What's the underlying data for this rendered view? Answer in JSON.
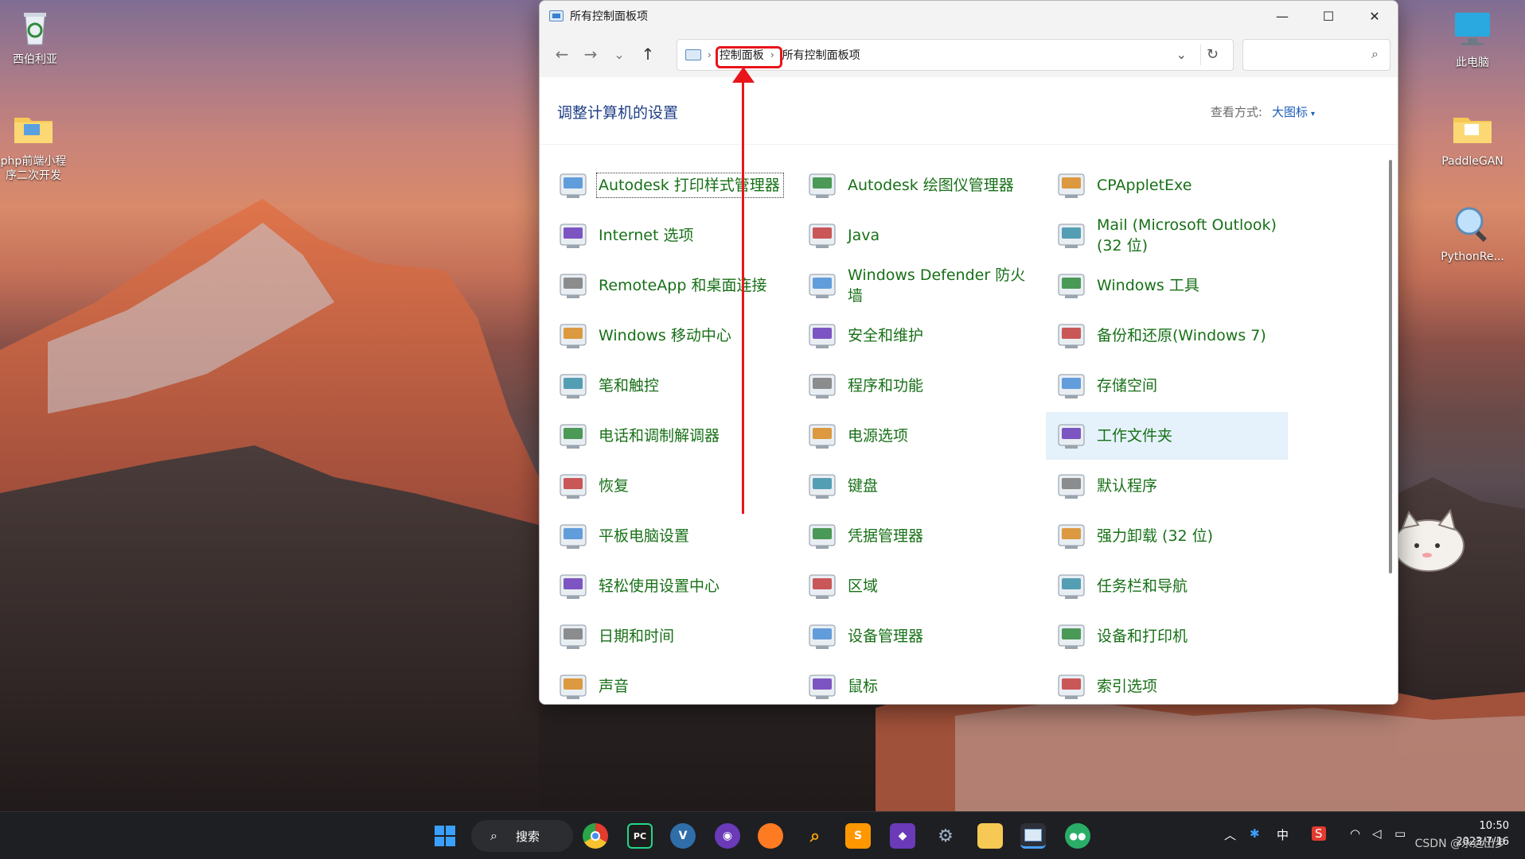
{
  "desktop": {
    "icons": [
      {
        "label": "西伯利亚"
      },
      {
        "label": "php前端小程序二次开发"
      },
      {
        "label": "此电脑"
      },
      {
        "label": "PaddleGAN"
      },
      {
        "label": "PythonRe..."
      }
    ]
  },
  "window": {
    "title": "所有控制面板项",
    "controls": {
      "minimize": "—",
      "maximize": "☐",
      "close": "✕"
    },
    "nav": {
      "back": "←",
      "forward": "→",
      "recent": "⌄",
      "up": "↑"
    },
    "address": {
      "crumb1": "控制面板",
      "crumb2": "所有控制面板项",
      "separator": "›",
      "dropdown": "⌄",
      "refresh": "↻"
    },
    "search": {
      "placeholder": "",
      "icon": "⌕"
    },
    "heading": "调整计算机的设置",
    "view_by": {
      "label": "查看方式:",
      "value": "大图标",
      "caret": "▾"
    }
  },
  "items": [
    {
      "label": "Autodesk 打印样式管理器",
      "icon": "printer-brush-icon",
      "focused": true
    },
    {
      "label": "Autodesk 绘图仪管理器",
      "icon": "plotter-icon"
    },
    {
      "label": "CPAppletExe",
      "icon": "blank-file-icon"
    },
    {
      "label": "Internet 选项",
      "icon": "globe-doc-icon"
    },
    {
      "label": "Java",
      "icon": "java-icon"
    },
    {
      "label": "Mail (Microsoft Outlook) (32 位)",
      "icon": "mail-icon"
    },
    {
      "label": "RemoteApp 和桌面连接",
      "icon": "remote-desktop-icon"
    },
    {
      "label": "Windows Defender 防火墙",
      "icon": "firewall-icon"
    },
    {
      "label": "Windows 工具",
      "icon": "gear-check-icon"
    },
    {
      "label": "Windows 移动中心",
      "icon": "mobility-center-icon"
    },
    {
      "label": "安全和维护",
      "icon": "flag-icon"
    },
    {
      "label": "备份和还原(Windows 7)",
      "icon": "backup-icon"
    },
    {
      "label": "笔和触控",
      "icon": "pen-icon"
    },
    {
      "label": "程序和功能",
      "icon": "programs-icon"
    },
    {
      "label": "存储空间",
      "icon": "storage-icon"
    },
    {
      "label": "电话和调制解调器",
      "icon": "phone-modem-icon"
    },
    {
      "label": "电源选项",
      "icon": "power-icon"
    },
    {
      "label": "工作文件夹",
      "icon": "work-folder-icon",
      "hover": true
    },
    {
      "label": "恢复",
      "icon": "recovery-icon"
    },
    {
      "label": "键盘",
      "icon": "keyboard-icon"
    },
    {
      "label": "默认程序",
      "icon": "default-programs-icon"
    },
    {
      "label": "平板电脑设置",
      "icon": "tablet-icon"
    },
    {
      "label": "凭据管理器",
      "icon": "credential-icon"
    },
    {
      "label": "强力卸载 (32 位)",
      "icon": "uninstall-clover-icon"
    },
    {
      "label": "轻松使用设置中心",
      "icon": "ease-of-access-icon"
    },
    {
      "label": "区域",
      "icon": "region-globe-icon"
    },
    {
      "label": "任务栏和导航",
      "icon": "taskbar-nav-icon"
    },
    {
      "label": "日期和时间",
      "icon": "calendar-clock-icon"
    },
    {
      "label": "设备管理器",
      "icon": "device-manager-icon"
    },
    {
      "label": "设备和打印机",
      "icon": "devices-printers-icon"
    },
    {
      "label": "声音",
      "icon": "speaker-icon"
    },
    {
      "label": "鼠标",
      "icon": "mouse-icon"
    },
    {
      "label": "索引选项",
      "icon": "index-icon"
    }
  ],
  "taskbar": {
    "search_label": "搜索",
    "search_icon": "⌕",
    "ime": "中",
    "tray_arrow": "︿",
    "time": "10:50",
    "date": "2023/7/16",
    "watermark": "CSDN @永远出步"
  }
}
